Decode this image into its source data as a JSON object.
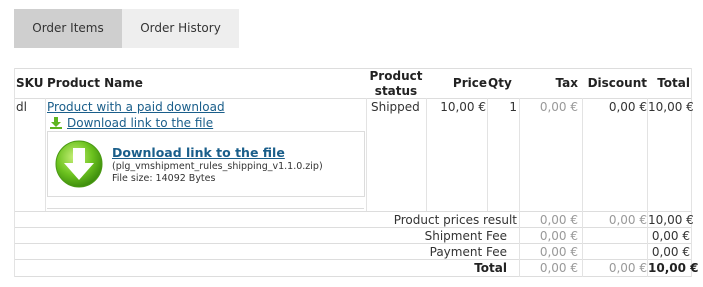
{
  "tabs": [
    {
      "label": "Order Items"
    },
    {
      "label": "Order History"
    }
  ],
  "table": {
    "headers": {
      "sku": "SKU",
      "product_name": "Product Name",
      "product_status_1": "Product",
      "product_status_2": "status",
      "price": "Price",
      "qty": "Qty",
      "tax": "Tax",
      "discount": "Discount",
      "total": "Total"
    },
    "item": {
      "sku": "dl",
      "product_name": "Product with a paid download",
      "download_link": "Download link to the file",
      "status": "Shipped",
      "price": "10,00 €",
      "qty": "1",
      "tax": "0,00 €",
      "discount": "0,00 €",
      "total": "10,00 €",
      "download_box": {
        "title": "Download link to the file",
        "file": "(plg_vmshipment_rules_shipping_v1.1.0.zip)",
        "size": "File size: 14092 Bytes"
      }
    },
    "summary": [
      {
        "label": "Product prices result",
        "tax": "0,00 €",
        "discount": "0,00 €",
        "total": "10,00 €"
      },
      {
        "label": "Shipment Fee",
        "tax": "0,00 €",
        "discount": "",
        "total": "0,00 €"
      },
      {
        "label": "Payment Fee",
        "tax": "0,00 €",
        "discount": "",
        "total": "0,00 €"
      },
      {
        "label": "Total",
        "tax": "0,00 €",
        "discount": "0,00 €",
        "total": "10,00 €"
      }
    ]
  },
  "colors": {
    "tab_active": "#cfcfcf",
    "tab_inactive": "#eeeeee",
    "link": "#1a5e8a",
    "muted": "#999999",
    "download_icon": "#5db51e"
  }
}
